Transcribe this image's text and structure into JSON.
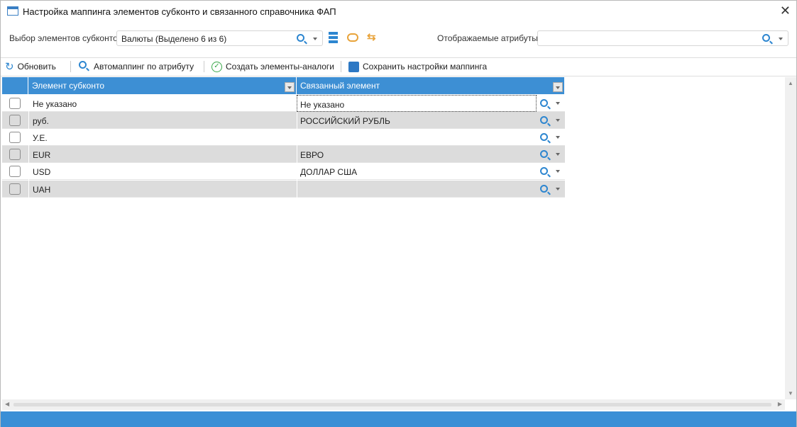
{
  "window": {
    "title": "Настройка маппинга элементов субконто и связанного справочника ФАП"
  },
  "filter": {
    "select_label": "Выбор элементов субконто",
    "select_value": "Валюты (Выделено 6 из 6)",
    "attrs_label": "Отображаемые атрибуты:",
    "attrs_value": ""
  },
  "toolbar": {
    "refresh": "Обновить",
    "automap": "Автомаппинг по атрибуту",
    "create": "Создать элементы-аналоги",
    "save": "Сохранить настройки маппинга"
  },
  "grid": {
    "columns": [
      "Элемент субконто",
      "Связанный элемент"
    ],
    "rows": [
      {
        "element": "Не указано",
        "linked": "Не указано"
      },
      {
        "element": "руб.",
        "linked": "РОССИЙСКИЙ РУБЛЬ"
      },
      {
        "element": "У.Е.",
        "linked": ""
      },
      {
        "element": "EUR",
        "linked": "ЕВРО"
      },
      {
        "element": "USD",
        "linked": "ДОЛЛАР США"
      },
      {
        "element": "UAH",
        "linked": ""
      }
    ]
  },
  "colors": {
    "accent": "#3d8fd4",
    "status_bar": "#3a8fd6"
  }
}
